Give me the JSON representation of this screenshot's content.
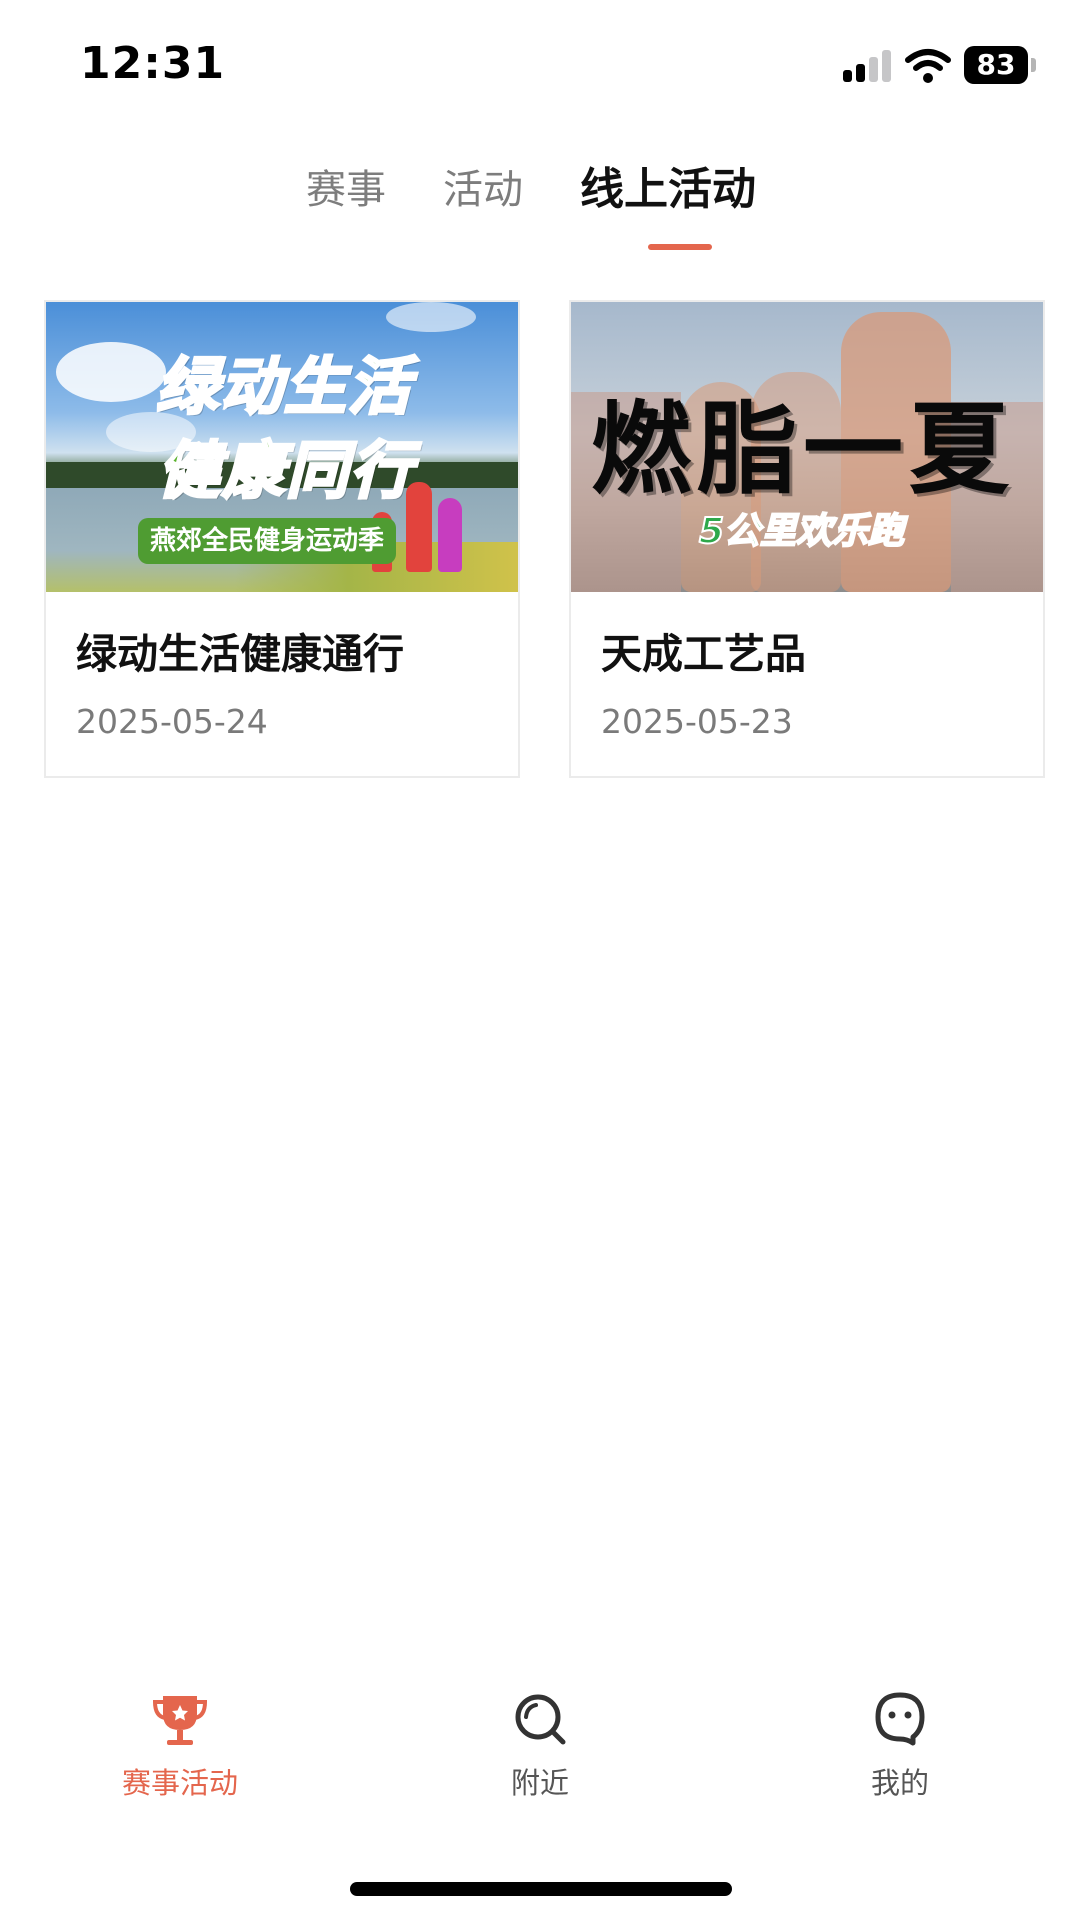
{
  "status_bar": {
    "time": "12:31",
    "battery": "83",
    "icons": [
      "signal-icon",
      "wifi-icon",
      "battery-icon"
    ]
  },
  "tabs": [
    {
      "label": "赛事",
      "active": false
    },
    {
      "label": "活动",
      "active": false
    },
    {
      "label": "线上活动",
      "active": true
    }
  ],
  "cards": [
    {
      "title": "绿动生活健康通行",
      "date": "2025-05-24",
      "banner": {
        "line1": "绿动生活",
        "line2": "健康同行",
        "tag": "燕郊全民健身运动季"
      }
    },
    {
      "title": "天成工艺品",
      "date": "2025-05-23",
      "banner": {
        "headline": "燃脂一夏",
        "tag": "5公里欢乐跑"
      }
    }
  ],
  "bottom_nav": [
    {
      "label": "赛事活动",
      "icon": "trophy-icon",
      "active": true
    },
    {
      "label": "附近",
      "icon": "search-icon",
      "active": false
    },
    {
      "label": "我的",
      "icon": "profile-icon",
      "active": false
    }
  ],
  "colors": {
    "accent": "#e4664d",
    "inactive_text": "#7d7d7d",
    "banner_green": "#5cb32e"
  }
}
